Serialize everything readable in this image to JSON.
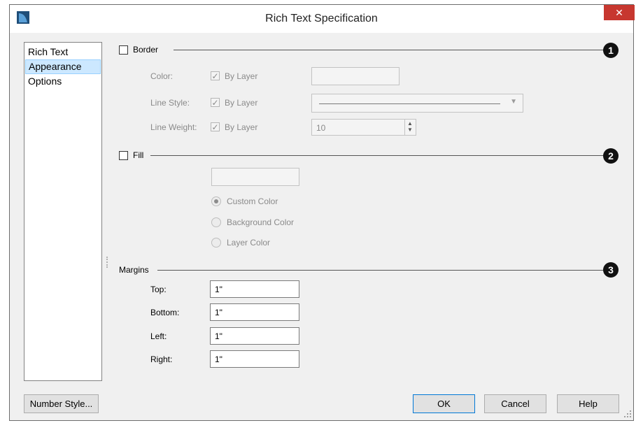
{
  "window": {
    "title": "Rich Text Specification",
    "close": "✕"
  },
  "nav": {
    "items": [
      "Rich Text",
      "Appearance",
      "Options"
    ],
    "selected": 1
  },
  "border": {
    "title": "Border",
    "callout": "1",
    "color_label": "Color:",
    "color_bylayer": "By Layer",
    "linestyle_label": "Line Style:",
    "linestyle_bylayer": "By Layer",
    "lineweight_label": "Line Weight:",
    "lineweight_bylayer": "By Layer",
    "lineweight_value": "10"
  },
  "fill": {
    "title": "Fill",
    "callout": "2",
    "options": [
      "Custom Color",
      "Background Color",
      "Layer Color"
    ],
    "selected": 0
  },
  "margins": {
    "title": "Margins",
    "callout": "3",
    "top_label": "Top:",
    "top_value": "1\"",
    "bottom_label": "Bottom:",
    "bottom_value": "1\"",
    "left_label": "Left:",
    "left_value": "1\"",
    "right_label": "Right:",
    "right_value": "1\""
  },
  "buttons": {
    "number_style": "Number Style...",
    "ok": "OK",
    "cancel": "Cancel",
    "help": "Help"
  },
  "colors": {
    "close_red": "#c7372f",
    "selection": "#cce8ff",
    "callout_black": "#111111"
  }
}
